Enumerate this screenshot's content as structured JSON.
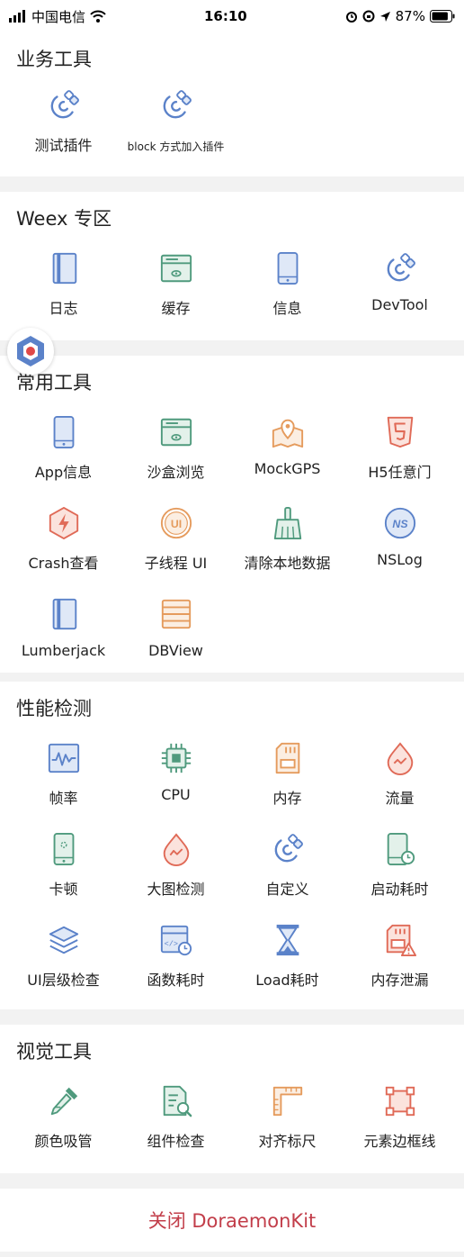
{
  "status_bar": {
    "carrier": "中国电信",
    "time": "16:10",
    "battery_percent": "87%",
    "battery_level": 0.87
  },
  "sections": [
    {
      "title": "业务工具",
      "items": [
        {
          "label": "测试插件",
          "icon": "magnet-icon"
        },
        {
          "label": "block 方式加入插件",
          "icon": "magnet-icon"
        }
      ]
    },
    {
      "title": "Weex 专区",
      "items": [
        {
          "label": "日志",
          "icon": "log-book-icon"
        },
        {
          "label": "缓存",
          "icon": "cache-icon"
        },
        {
          "label": "信息",
          "icon": "phone-icon"
        },
        {
          "label": "DevTool",
          "icon": "magnet-icon"
        }
      ]
    },
    {
      "title": "常用工具",
      "items": [
        {
          "label": "App信息",
          "icon": "phone-icon"
        },
        {
          "label": "沙盒浏览",
          "icon": "cache-icon"
        },
        {
          "label": "MockGPS",
          "icon": "map-pin-icon"
        },
        {
          "label": "H5任意门",
          "icon": "html5-icon"
        },
        {
          "label": "Crash查看",
          "icon": "crash-icon"
        },
        {
          "label": "子线程 UI",
          "icon": "ui-thread-icon"
        },
        {
          "label": "清除本地数据",
          "icon": "broom-icon"
        },
        {
          "label": "NSLog",
          "icon": "nslog-icon"
        },
        {
          "label": "Lumberjack",
          "icon": "log-book-icon"
        },
        {
          "label": "DBView",
          "icon": "database-icon"
        }
      ]
    },
    {
      "title": "性能检测",
      "items": [
        {
          "label": "帧率",
          "icon": "fps-icon"
        },
        {
          "label": "CPU",
          "icon": "cpu-icon"
        },
        {
          "label": "内存",
          "icon": "memory-card-icon"
        },
        {
          "label": "流量",
          "icon": "traffic-drop-icon"
        },
        {
          "label": "卡顿",
          "icon": "lag-phone-icon"
        },
        {
          "label": "大图检测",
          "icon": "image-drop-icon"
        },
        {
          "label": "自定义",
          "icon": "magnet-icon"
        },
        {
          "label": "启动耗时",
          "icon": "launch-time-icon"
        },
        {
          "label": "UI层级检查",
          "icon": "layers-icon"
        },
        {
          "label": "函数耗时",
          "icon": "function-time-icon"
        },
        {
          "label": "Load耗时",
          "icon": "hourglass-icon"
        },
        {
          "label": "内存泄漏",
          "icon": "memory-leak-icon"
        }
      ]
    },
    {
      "title": "视觉工具",
      "items": [
        {
          "label": "颜色吸管",
          "icon": "eyedropper-icon"
        },
        {
          "label": "组件检查",
          "icon": "component-search-icon"
        },
        {
          "label": "对齐标尺",
          "icon": "ruler-icon"
        },
        {
          "label": "元素边框线",
          "icon": "border-frame-icon"
        }
      ]
    }
  ],
  "close_button": "关闭 DoraemonKit",
  "colors": {
    "blue": "#5b82c9",
    "green": "#4f9a7d",
    "orange": "#e59b5d",
    "red": "#e06a57",
    "close_text": "#c23e4a"
  }
}
